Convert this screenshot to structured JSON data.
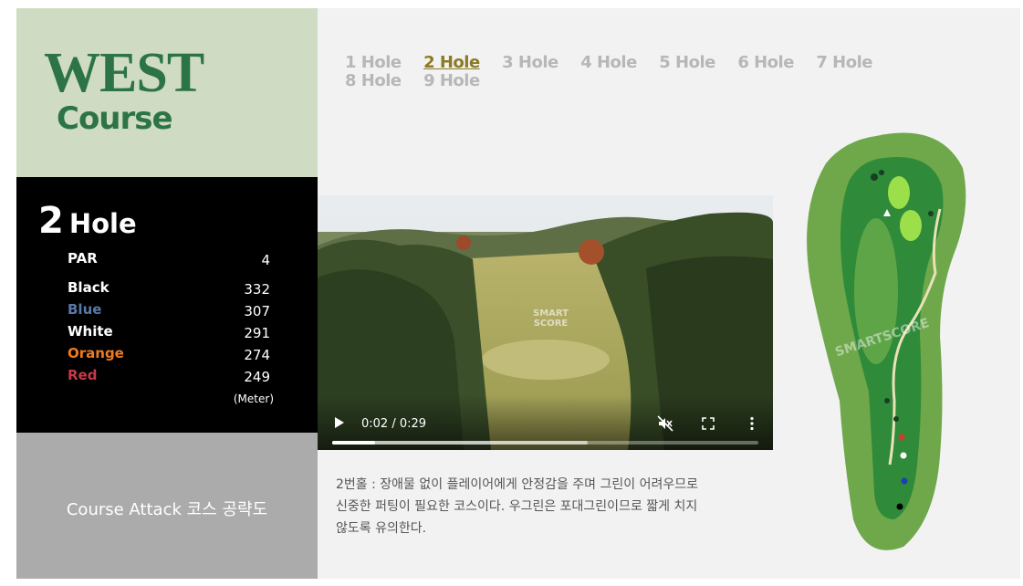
{
  "brand": {
    "line1": "WEST",
    "line2": "Course",
    "colors": {
      "brand_bg": "#cfdbc2",
      "brand_text": "#2c7446"
    }
  },
  "hole_info": {
    "number": "2",
    "word": "Hole",
    "par_label": "PAR",
    "par_value": "4",
    "tees": [
      {
        "label": "Black",
        "value": "332",
        "color": "#ffffff"
      },
      {
        "label": "Blue",
        "value": "307",
        "color": "#5a78a6"
      },
      {
        "label": "White",
        "value": "291",
        "color": "#ffffff"
      },
      {
        "label": "Orange",
        "value": "274",
        "color": "#f07a1e"
      },
      {
        "label": "Red",
        "value": "249",
        "color": "#c8384a"
      }
    ],
    "unit": "(Meter)"
  },
  "attack": {
    "label": "Course Attack 코스 공략도"
  },
  "tabs": [
    {
      "label": "1 Hole",
      "active": false
    },
    {
      "label": "2 Hole",
      "active": true
    },
    {
      "label": "3 Hole",
      "active": false
    },
    {
      "label": "4 Hole",
      "active": false
    },
    {
      "label": "5 Hole",
      "active": false
    },
    {
      "label": "6 Hole",
      "active": false
    },
    {
      "label": "7 Hole",
      "active": false
    },
    {
      "label": "8 Hole",
      "active": false
    },
    {
      "label": "9 Hole",
      "active": false
    }
  ],
  "video": {
    "time": "0:02 / 0:29",
    "watermark_line1": "SMART",
    "watermark_line2": "SCORE",
    "progress_fraction": 0.1,
    "buffer_fraction": 0.6,
    "icons": [
      "play-icon",
      "mute-icon",
      "fullscreen-icon",
      "more-options-icon"
    ]
  },
  "description": "2번홀 : 장애물 없이 플레이어에게 안정감을 주며 그린이 어려우므로 신중한 퍼팅이 필요한 코스이다. 우그린은 포대그린이므로 짧게 치지 않도록 유의한다.",
  "map": {
    "watermark": "SMARTSCORE",
    "colors": {
      "rough": "#6fa84a",
      "fairway": "#2f8a3a",
      "green": "#9be04a"
    }
  }
}
